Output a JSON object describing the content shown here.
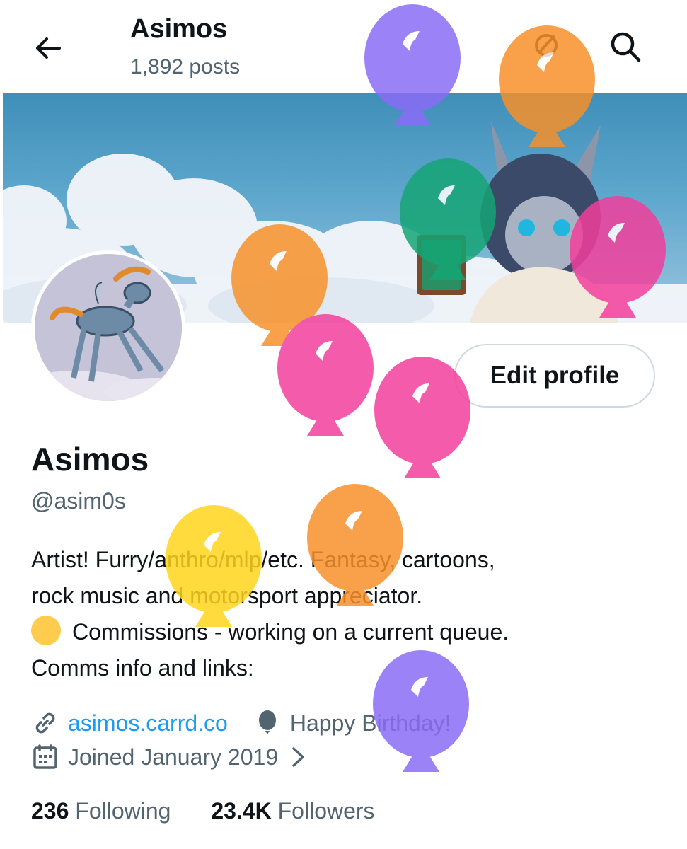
{
  "header": {
    "title": "Asimos",
    "posts": "1,892 posts"
  },
  "profile": {
    "edit_label": "Edit profile",
    "name": "Asimos",
    "handle": "@asim0s",
    "bio_line1": "Artist! Furry/anthro/mlp/etc. Fantasy, cartoons,",
    "bio_line2": "rock music and motorsport appreciator.",
    "bio_line3": "Commissions - working on a current queue.",
    "bio_line4": "Comms info and links:",
    "link": "asimos.carrd.co",
    "birthday": "Happy Birthday!",
    "joined": "Joined January 2019",
    "following_count": "236",
    "following_label": "Following",
    "followers_count": "23.4K",
    "followers_label": "Followers"
  },
  "icons": [
    "back-arrow-icon",
    "search-icon",
    "trending-icon",
    "link-icon",
    "balloon-icon",
    "calendar-icon",
    "chevron-right-icon"
  ],
  "colors": {
    "link": "#1d9bf0",
    "secondary_text": "#536471",
    "balloon_purple": "#8b6cf6",
    "balloon_orange": "#f7902a",
    "balloon_pink": "#f23e9b",
    "balloon_green": "#16a574",
    "balloon_yellow": "#ffd51c",
    "status_dot": "#ffcc4d"
  }
}
